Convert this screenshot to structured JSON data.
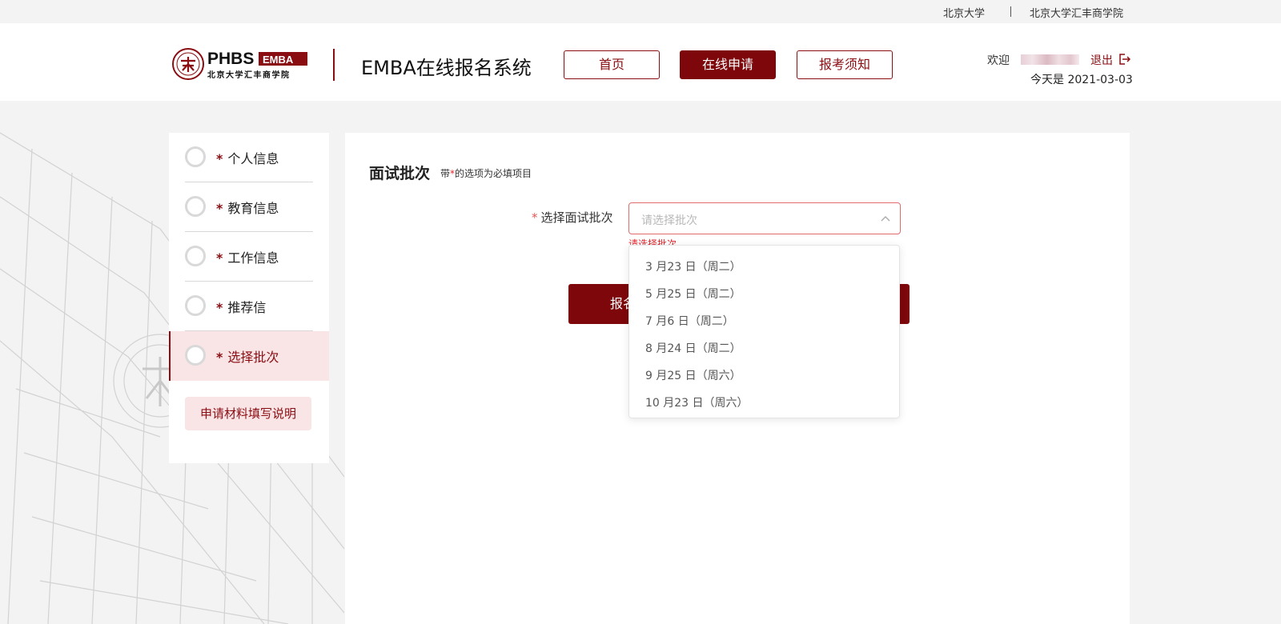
{
  "topbar": {
    "link_pku": "北京大学",
    "link_phbs": "北京大学汇丰商学院"
  },
  "header": {
    "logo_text": "PHBS",
    "logo_badge": "EMBA",
    "logo_subtitle": "北京大学汇丰商学院",
    "system_title": "EMBA在线报名系统",
    "nav": [
      {
        "label": "首页",
        "active": false
      },
      {
        "label": "在线申请",
        "active": true
      },
      {
        "label": "报考须知",
        "active": false
      }
    ],
    "welcome": "欢迎",
    "logout": "退出",
    "today": "今天是 2021-03-03"
  },
  "sidebar": {
    "steps": [
      {
        "label": "个人信息",
        "required": "*",
        "active": false
      },
      {
        "label": "教育信息",
        "required": "*",
        "active": false
      },
      {
        "label": "工作信息",
        "required": "*",
        "active": false
      },
      {
        "label": "推荐信",
        "required": "*",
        "active": false
      },
      {
        "label": "选择批次",
        "required": "*",
        "active": true
      }
    ],
    "guide_button": "申请材料填写说明"
  },
  "main": {
    "section_title": "面试批次",
    "hint_prefix": "带",
    "hint_star": "*",
    "hint_suffix": "的选项为必填项目",
    "field_star": "*",
    "field_label": "选择面试批次",
    "select_placeholder": "请选择批次",
    "error_text": "请选择批次",
    "submit_label": "报名",
    "options": [
      "3 月23 日（周二）",
      "5 月25 日（周二）",
      "7 月6 日（周二）",
      "8 月24 日（周二）",
      "9 月25 日（周六）",
      "10 月23 日（周六）"
    ]
  },
  "colors": {
    "brand": "#7d070b",
    "brand_light": "#f9e4e6",
    "error": "#e0262c"
  },
  "icons": {
    "logo": "pku-seal-icon",
    "logout": "logout-icon",
    "select_chevron": "chevron-up-icon",
    "step_status": "circle-icon"
  }
}
